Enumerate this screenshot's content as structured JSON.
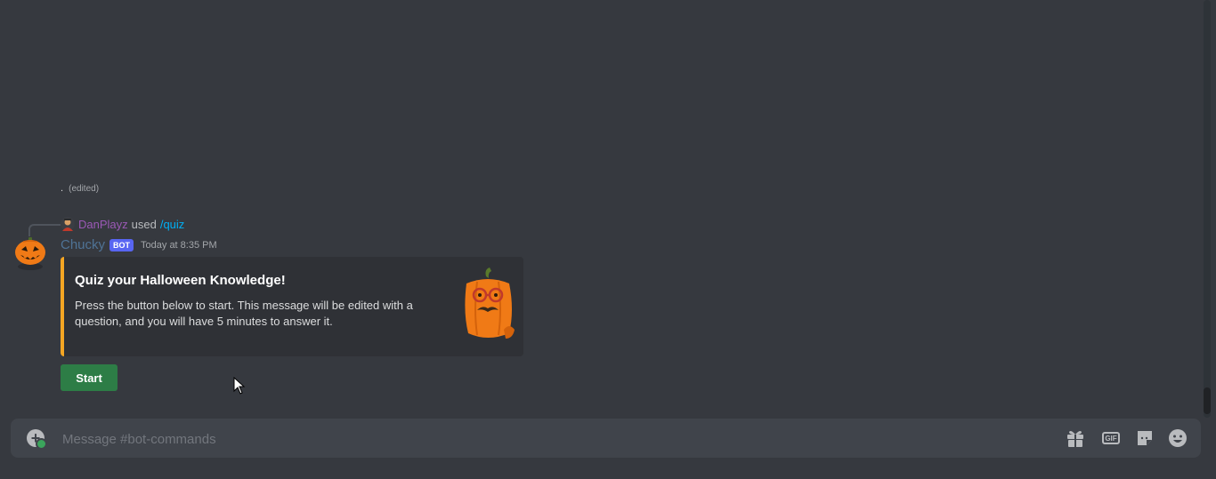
{
  "channel": "bot-commands",
  "previous_message": {
    "text": ".",
    "edited_label": "(edited)"
  },
  "reply": {
    "user": "DanPlayz",
    "used_label": "used",
    "command": "/quiz"
  },
  "message": {
    "author": "Chucky",
    "bot_tag": "BOT",
    "timestamp": "Today at 8:35 PM",
    "avatar_icon": "jack-o-lantern-icon",
    "embed": {
      "accent_color": "#f5a623",
      "title": "Quiz your Halloween Knowledge!",
      "description": "Press the button below to start. This message will be edited with a question, and you will have 5 minutes to answer it.",
      "thumbnail_icon": "pumpkin-with-glasses-icon"
    },
    "button": {
      "label": "Start",
      "color": "#2d7d46"
    }
  },
  "composer": {
    "placeholder": "Message #bot-commands",
    "tools": [
      "gift-icon",
      "gif-icon",
      "sticker-icon",
      "emoji-icon"
    ],
    "gif_label": "GIF"
  }
}
